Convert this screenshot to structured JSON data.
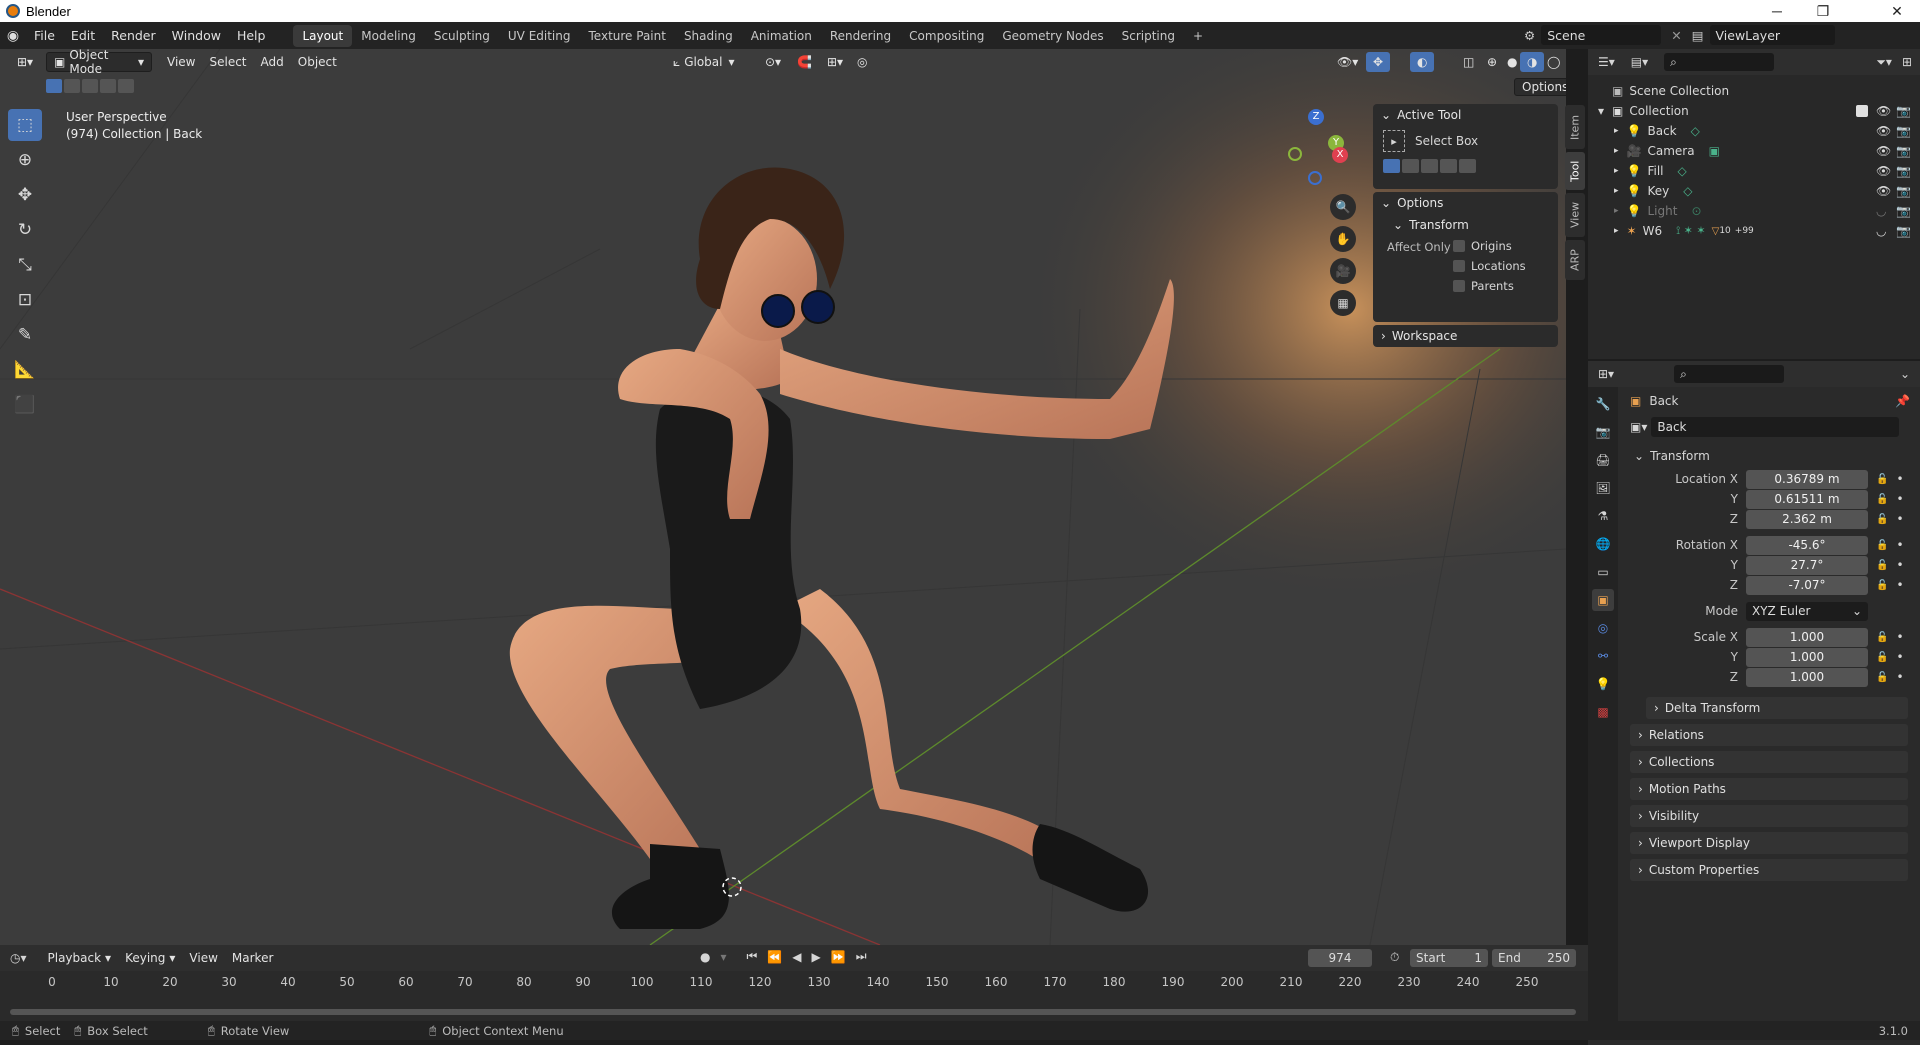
{
  "app_title": "Blender",
  "menu": [
    "File",
    "Edit",
    "Render",
    "Window",
    "Help"
  ],
  "workspaces": [
    "Layout",
    "Modeling",
    "Sculpting",
    "UV Editing",
    "Texture Paint",
    "Shading",
    "Animation",
    "Rendering",
    "Compositing",
    "Geometry Nodes",
    "Scripting"
  ],
  "active_workspace": "Layout",
  "scene": "Scene",
  "view_layer": "ViewLayer",
  "viewport": {
    "mode": "Object Mode",
    "menus": [
      "View",
      "Select",
      "Add",
      "Object"
    ],
    "orientation": "Global",
    "options_label": "Options",
    "overlay_line1": "User Perspective",
    "overlay_line2": "(974) Collection | Back",
    "gizmo_axes": [
      "Z",
      "Y",
      "X"
    ]
  },
  "npanel": {
    "active_tool_title": "Active Tool",
    "tool_name": "Select Box",
    "options_title": "Options",
    "transform_title": "Transform",
    "affect_only": "Affect Only",
    "checks": [
      "Origins",
      "Locations",
      "Parents"
    ],
    "workspace_title": "Workspace",
    "tabs": [
      "Item",
      "Tool",
      "View",
      "ARP"
    ]
  },
  "outliner": {
    "scene_collection": "Scene Collection",
    "collection": "Collection",
    "items": [
      {
        "name": "Back",
        "color": "#e8a050"
      },
      {
        "name": "Camera",
        "color": "#e8a050"
      },
      {
        "name": "Fill",
        "color": "#e8a050"
      },
      {
        "name": "Key",
        "color": "#e8a050"
      },
      {
        "name": "Light",
        "color": "#e8a050"
      },
      {
        "name": "W6",
        "color": "#e8a050"
      }
    ],
    "w6_badge1": "10",
    "w6_badge2": "+99"
  },
  "properties": {
    "object_name": "Back",
    "datablock": "Back",
    "transform_title": "Transform",
    "location": {
      "label_x": "Location X",
      "label_y": "Y",
      "label_z": "Z",
      "x": "0.36789 m",
      "y": "0.61511 m",
      "z": "2.362 m"
    },
    "rotation": {
      "label_x": "Rotation X",
      "label_y": "Y",
      "label_z": "Z",
      "x": "-45.6°",
      "y": "27.7°",
      "z": "-7.07°"
    },
    "mode_label": "Mode",
    "mode_value": "XYZ Euler",
    "scale": {
      "label_x": "Scale X",
      "label_y": "Y",
      "label_z": "Z",
      "x": "1.000",
      "y": "1.000",
      "z": "1.000"
    },
    "delta": "Delta Transform",
    "sections": [
      "Relations",
      "Collections",
      "Motion Paths",
      "Visibility",
      "Viewport Display",
      "Custom Properties"
    ]
  },
  "timeline": {
    "menus": [
      "Playback",
      "Keying",
      "View",
      "Marker"
    ],
    "current_frame": "974",
    "start_label": "Start",
    "start": "1",
    "end_label": "End",
    "end": "250",
    "ticks": [
      "0",
      "10",
      "20",
      "30",
      "40",
      "50",
      "60",
      "70",
      "80",
      "90",
      "100",
      "110",
      "120",
      "130",
      "140",
      "150",
      "160",
      "170",
      "180",
      "190",
      "200",
      "210",
      "220",
      "230",
      "240",
      "250"
    ]
  },
  "status": {
    "select": "Select",
    "box_select": "Box Select",
    "rotate": "Rotate View",
    "context": "Object Context Menu",
    "version": "3.1.0"
  }
}
